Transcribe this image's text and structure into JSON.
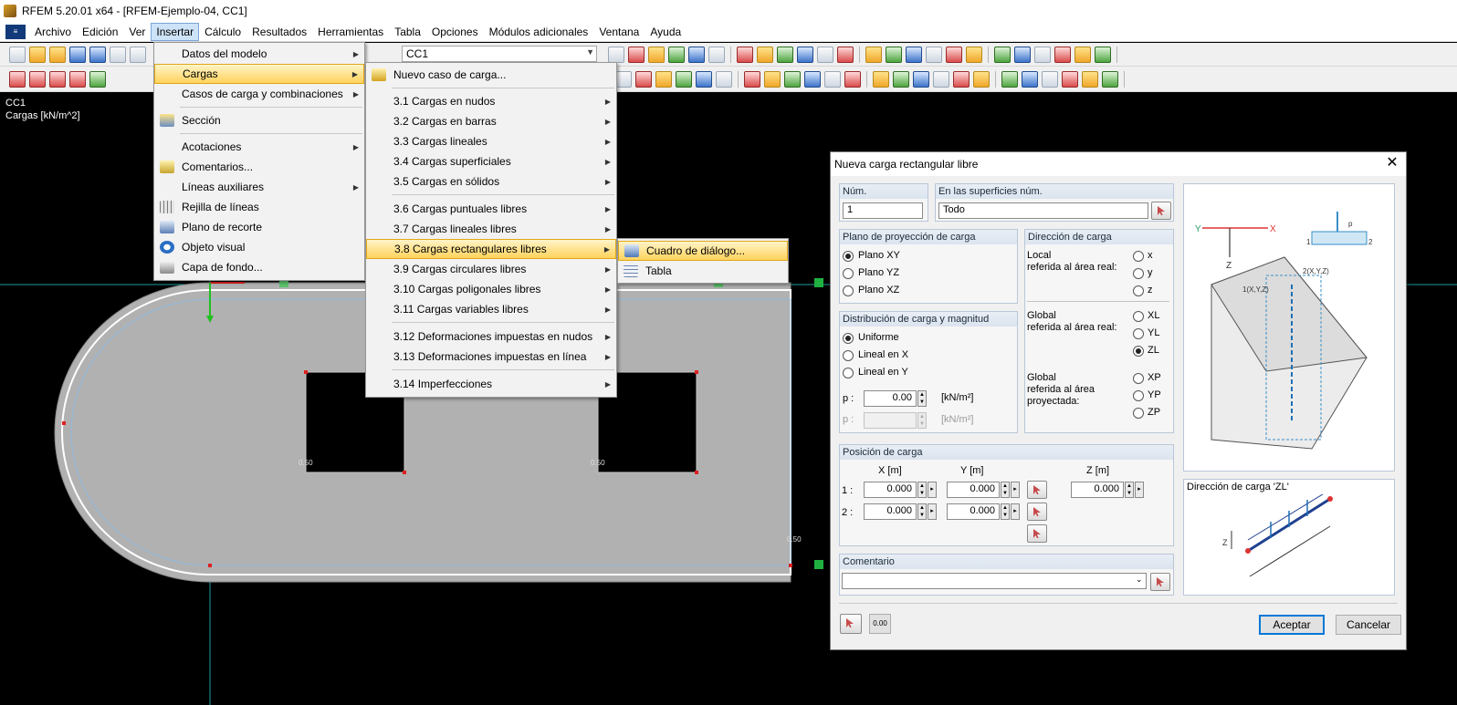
{
  "window": {
    "title": "RFEM 5.20.01 x64 - [RFEM-Ejemplo-04, CC1]"
  },
  "menubar": {
    "items": [
      "Archivo",
      "Edición",
      "Ver",
      "Insertar",
      "Cálculo",
      "Resultados",
      "Herramientas",
      "Tabla",
      "Opciones",
      "Módulos adicionales",
      "Ventana",
      "Ayuda"
    ],
    "active": "Insertar"
  },
  "toolbar": {
    "loadcase": "CC1"
  },
  "workspace": {
    "info_line1": "CC1",
    "info_line2": "Cargas [kN/m^2]",
    "dim_a": "0.50",
    "dim_b": "0.50",
    "dim_c": "0.50"
  },
  "menu_insertar": {
    "items": [
      {
        "label": "Datos del modelo",
        "submenu": true
      },
      {
        "label": "Cargas",
        "submenu": true,
        "highlighted": true
      },
      {
        "label": "Casos de carga y combinaciones",
        "submenu": true
      },
      {
        "label": "Sección",
        "submenu": false
      },
      {
        "label": "Acotaciones",
        "submenu": true
      },
      {
        "label": "Comentarios...",
        "submenu": false
      },
      {
        "label": "Líneas auxiliares",
        "submenu": true
      },
      {
        "label": "Rejilla de líneas",
        "submenu": false
      },
      {
        "label": "Plano de recorte",
        "submenu": false
      },
      {
        "label": "Objeto visual",
        "submenu": false
      },
      {
        "label": "Capa de fondo...",
        "submenu": false
      }
    ]
  },
  "menu_cargas": {
    "items": [
      {
        "label": "Nuevo caso de carga...",
        "submenu": false
      },
      {
        "label": "3.1 Cargas en nudos",
        "submenu": true
      },
      {
        "label": "3.2 Cargas en barras",
        "submenu": true
      },
      {
        "label": "3.3 Cargas lineales",
        "submenu": true
      },
      {
        "label": "3.4 Cargas superficiales",
        "submenu": true
      },
      {
        "label": "3.5 Cargas en sólidos",
        "submenu": true
      },
      {
        "label": "3.6 Cargas puntuales libres",
        "submenu": true
      },
      {
        "label": "3.7 Cargas lineales libres",
        "submenu": true
      },
      {
        "label": "3.8 Cargas rectangulares libres",
        "submenu": true,
        "highlighted": true
      },
      {
        "label": "3.9 Cargas circulares libres",
        "submenu": true
      },
      {
        "label": "3.10 Cargas poligonales libres",
        "submenu": true
      },
      {
        "label": "3.11 Cargas variables libres",
        "submenu": true
      },
      {
        "label": "3.12 Deformaciones impuestas en nudos",
        "submenu": true
      },
      {
        "label": "3.13 Deformaciones impuestas en línea",
        "submenu": true
      },
      {
        "label": "3.14 Imperfecciones",
        "submenu": true
      }
    ]
  },
  "menu_rect": {
    "items": [
      {
        "label": "Cuadro de diálogo...",
        "highlighted": true
      },
      {
        "label": "Tabla",
        "highlighted": false
      }
    ]
  },
  "dialog": {
    "title": "Nueva carga rectangular libre",
    "num_label": "Núm.",
    "num_value": "1",
    "surfaces_label": "En las superficies núm.",
    "surfaces_value": "Todo",
    "projection": {
      "title": "Plano de proyección de carga",
      "options": [
        "Plano XY",
        "Plano YZ",
        "Plano XZ"
      ],
      "selected": "Plano XY"
    },
    "direction": {
      "title": "Dirección de carga",
      "local_label": "Local referida al área real:",
      "local_l1": "Local",
      "local_l2": "referida al área real:",
      "local_opts": [
        "x",
        "y",
        "z"
      ],
      "global_l1": "Global",
      "global_l2": "referida al área real:",
      "global_opts": [
        "XL",
        "YL",
        "ZL"
      ],
      "proj_l1": "Global",
      "proj_l2": "referida al área",
      "proj_l3": "proyectada:",
      "proj_opts": [
        "XP",
        "YP",
        "ZP"
      ],
      "selected": "ZL"
    },
    "distribution": {
      "title": "Distribución de carga y magnitud",
      "options": [
        "Uniforme",
        "Lineal en  X",
        "Lineal en  Y"
      ],
      "selected": "Uniforme",
      "p_label": "p :",
      "p_value": "0.00",
      "p_unit": "[kN/m²]",
      "p2_label": "p :",
      "p2_value": "",
      "p2_unit": "[kN/m²]"
    },
    "position": {
      "title": "Posición de carga",
      "x_head": "X  [m]",
      "y_head": "Y  [m]",
      "z_head": "Z  [m]",
      "row1_label": "1 :",
      "row2_label": "2 :",
      "x1": "0.000",
      "y1": "0.000",
      "z1": "0.000",
      "x2": "0.000",
      "y2": "0.000"
    },
    "comment": {
      "title": "Comentario",
      "value": ""
    },
    "image2_caption": "Dirección de carga 'ZL'",
    "fig_labels": {
      "y": "Y",
      "x": "X",
      "z": "Z",
      "p": "p",
      "n1": "1",
      "n2": "2",
      "pt2": "2(X,Y,Z)",
      "pt1": "1(X,Y,Z)"
    },
    "ok": "Aceptar",
    "cancel": "Cancelar",
    "units_btn": "0.00"
  }
}
